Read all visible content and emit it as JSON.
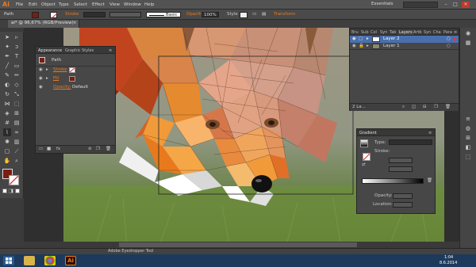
{
  "app": {
    "logo": "Ai",
    "workspace": "Essentials"
  },
  "menu": [
    "File",
    "Edit",
    "Object",
    "Type",
    "Select",
    "Effect",
    "View",
    "Window",
    "Help"
  ],
  "control_bar": {
    "selection_label": "Path",
    "stroke_label": "Stroke",
    "stroke_profile": "Basic",
    "opacity_label": "Opacity",
    "opacity_value": "100%",
    "style_label": "Style",
    "transform_label": "Transform"
  },
  "document_tab": {
    "title": "ai* @ 96,67% (RGB/Preview)",
    "close": "×"
  },
  "appearance_panel": {
    "tabs": [
      "Appearance",
      "Graphic Styles"
    ],
    "object_label": "Path",
    "rows": [
      {
        "label": "Stroke"
      },
      {
        "label": "Fill"
      },
      {
        "label": "Opacity:",
        "value": "Default"
      }
    ]
  },
  "layers_panel": {
    "tabs": [
      "Bru",
      "Sub",
      "Col",
      "Syn",
      "Tab",
      "Layers",
      "Artb",
      "Syn",
      "Cha",
      "Para"
    ],
    "layers": [
      {
        "name": "Layer 2"
      },
      {
        "name": "Layer 1"
      }
    ],
    "footer": "2 La..."
  },
  "gradient_panel": {
    "tab": "Gradient",
    "type_label": "Type:",
    "stroke_label": "Stroke:",
    "opacity_label": "Opacity:",
    "location_label": "Location:"
  },
  "status": {
    "tool": "Adobe Eyedropper Tool"
  },
  "taskbar": {
    "time": "1:04",
    "date": "8.6.2014"
  },
  "colors": {
    "accent": "#e87a1d",
    "fill_swatch": "#7a1e12",
    "taskbar": "#1d3a5c",
    "selection_blue": "#4a6fae"
  }
}
